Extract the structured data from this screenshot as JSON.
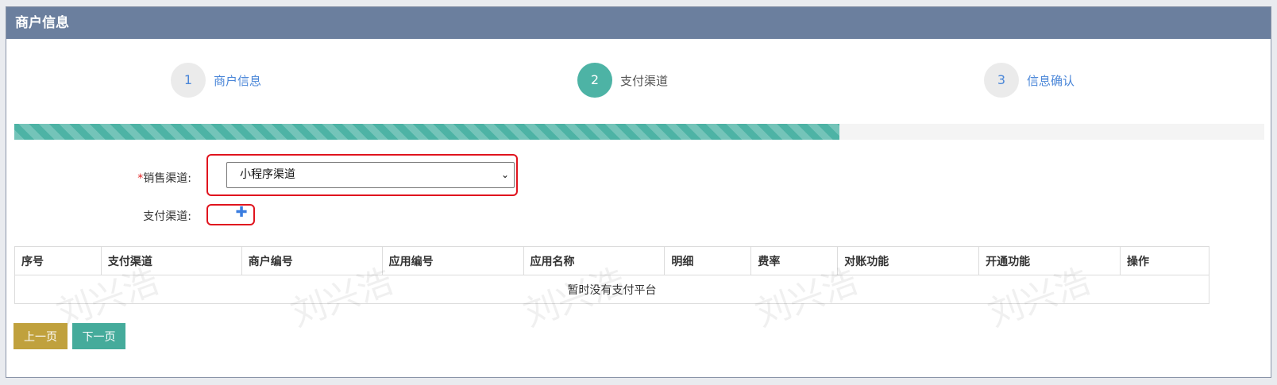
{
  "panel": {
    "title": "商户信息"
  },
  "steps": [
    {
      "number": "1",
      "label": "商户信息",
      "active": false
    },
    {
      "number": "2",
      "label": "支付渠道",
      "active": true
    },
    {
      "number": "3",
      "label": "信息确认",
      "active": false
    }
  ],
  "progress": {
    "percent": 66,
    "color": "#4db3a5"
  },
  "form": {
    "sales_channel": {
      "required_mark": "*",
      "label": "销售渠道:",
      "selected": "小程序渠道"
    },
    "pay_channel": {
      "label": "支付渠道:",
      "add_icon": "plus-icon"
    }
  },
  "table": {
    "headers": [
      "序号",
      "支付渠道",
      "商户编号",
      "应用编号",
      "应用名称",
      "明细",
      "费率",
      "对账功能",
      "开通功能",
      "操作"
    ],
    "empty_text": "暂时没有支付平台",
    "watermark": "刘兴浩"
  },
  "buttons": {
    "prev": "上一页",
    "next": "下一页"
  },
  "colors": {
    "header_bg": "#6b7f9e",
    "accent": "#4db3a5",
    "prev_btn": "#c0a13d",
    "highlight": "#e0141e"
  }
}
